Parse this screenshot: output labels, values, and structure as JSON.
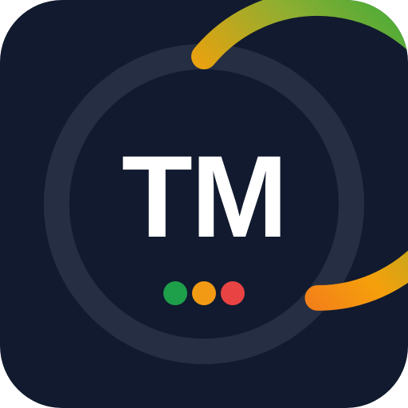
{
  "app_icon": {
    "monogram": "TM",
    "background_color": "#111a2e",
    "monogram_color": "#ffffff",
    "ring": {
      "track_color": "#252e42",
      "progress_fraction": 0.64,
      "gradient_stops": [
        "#f15a2b",
        "#f5a00b",
        "#8dae31",
        "#4dab38",
        "#f3ae1a"
      ]
    },
    "status_dots": [
      {
        "name": "green",
        "color": "#1e9f4a"
      },
      {
        "name": "orange",
        "color": "#f39a14"
      },
      {
        "name": "red",
        "color": "#ea4343"
      }
    ]
  }
}
